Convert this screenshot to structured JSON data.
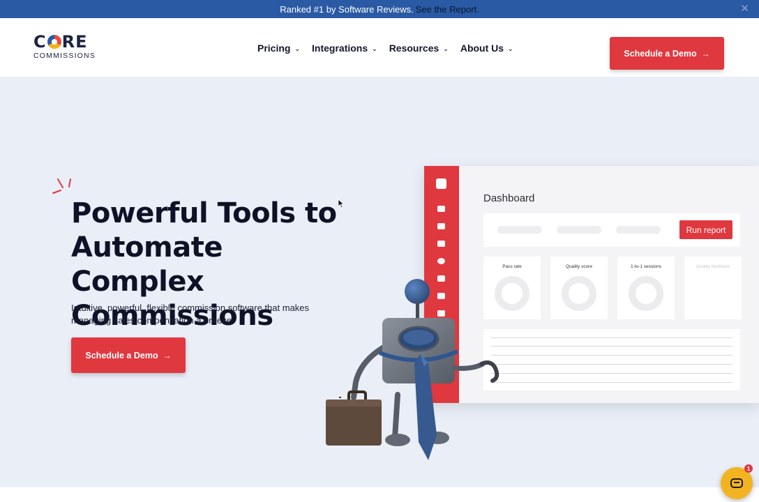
{
  "announcement": {
    "text": "Ranked #1 by Software Reviews.",
    "link_text": "See the Report.",
    "close_glyph": "✕"
  },
  "brand": {
    "logo_word_left": "C",
    "logo_word_right": "RE",
    "logo_sub": "COMMISSIONS"
  },
  "nav": {
    "items": [
      {
        "label": "Pricing"
      },
      {
        "label": "Integrations"
      },
      {
        "label": "Resources"
      },
      {
        "label": "About Us"
      }
    ],
    "chevron_icon": "chevron-down-icon"
  },
  "header_cta": {
    "label": "Schedule a Demo",
    "arrow": "→"
  },
  "hero": {
    "title_line1": "Powerful Tools to",
    "title_line2": "Automate Complex",
    "title_line3": "Commissions",
    "subtitle": "Intuitive, powerful, flexible commission software that makes managing sales compensation a breeze.",
    "cta_label": "Schedule a Demo",
    "cta_arrow": "→"
  },
  "dashboard_mock": {
    "title": "Dashboard",
    "run_button": "Run report",
    "cards": [
      "Pass rate",
      "Quality score",
      "1-to-1 sessions",
      "Quality feedback"
    ]
  },
  "chat": {
    "badge_count": "1"
  },
  "colors": {
    "accent_red": "#e0383f",
    "announce_blue": "#2a5aa3",
    "hero_bg": "#eaeef7",
    "chat_yellow": "#f2b320"
  }
}
